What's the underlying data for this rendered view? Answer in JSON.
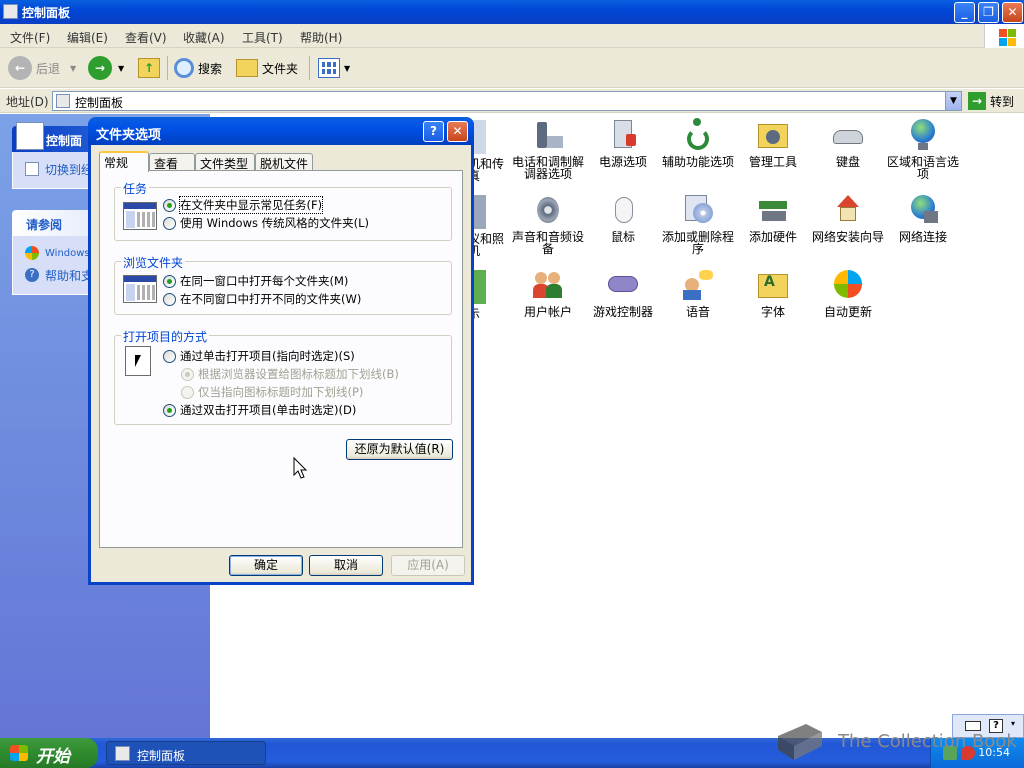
{
  "window": {
    "title": "控制面板",
    "menu": [
      "文件(F)",
      "编辑(E)",
      "查看(V)",
      "收藏(A)",
      "工具(T)",
      "帮助(H)"
    ],
    "toolbar": {
      "back": "后退",
      "search": "搜索",
      "folders": "文件夹"
    },
    "address": {
      "label": "地址(D)",
      "value": "控制面板",
      "go": "转到"
    }
  },
  "leftpane": {
    "panel_title": "控制面",
    "switch_view": "切换到经典视图",
    "see_also_title": "请参阅",
    "see_also": [
      "Windows Update",
      "帮助和支持"
    ]
  },
  "cp_items": [
    {
      "id": "phone",
      "label": "电话和调制解调器选项"
    },
    {
      "id": "power",
      "label": "电源选项"
    },
    {
      "id": "access",
      "label": "辅助功能选项"
    },
    {
      "id": "admin",
      "label": "管理工具"
    },
    {
      "id": "keyboard",
      "label": "键盘"
    },
    {
      "id": "region",
      "label": "区域和语言选项"
    },
    {
      "id": "sound",
      "label": "声音和音频设备"
    },
    {
      "id": "mouse",
      "label": "鼠标"
    },
    {
      "id": "addremove",
      "label": "添加或删除程序"
    },
    {
      "id": "addhw",
      "label": "添加硬件"
    },
    {
      "id": "netsetup",
      "label": "网络安装向导"
    },
    {
      "id": "netconn",
      "label": "网络连接"
    },
    {
      "id": "users",
      "label": "用户帐户"
    },
    {
      "id": "game",
      "label": "游戏控制器"
    },
    {
      "id": "speech",
      "label": "语音"
    },
    {
      "id": "fonts",
      "label": "字体"
    },
    {
      "id": "autoupdate",
      "label": "自动更新"
    }
  ],
  "partial_items": {
    "r1a": "机和传",
    "r1b": "真",
    "r2a": "仪和照",
    "r2b": "机",
    "r3a": "示"
  },
  "dialog": {
    "title": "文件夹选项",
    "help": "?",
    "tabs": [
      "常规",
      "查看",
      "文件类型",
      "脱机文件"
    ],
    "groups": {
      "tasks": {
        "legend": "任务",
        "opt1": "在文件夹中显示常见任务(F)",
        "opt2": "使用 Windows 传统风格的文件夹(L)"
      },
      "browse": {
        "legend": "浏览文件夹",
        "opt1": "在同一窗口中打开每个文件夹(M)",
        "opt2": "在不同窗口中打开不同的文件夹(W)"
      },
      "click": {
        "legend": "打开项目的方式",
        "opt1": "通过单击打开项目(指向时选定)(S)",
        "sub1": "根据浏览器设置给图标标题加下划线(B)",
        "sub2": "仅当指向图标标题时加下划线(P)",
        "opt2": "通过双击打开项目(单击时选定)(D)"
      }
    },
    "restore": "还原为默认值(R)",
    "ok": "确定",
    "cancel": "取消",
    "apply": "应用(A)"
  },
  "taskbar": {
    "start": "开始",
    "task": "控制面板",
    "clock": "10:54"
  },
  "watermark": "The Collection Book",
  "colors": {
    "xp_blue": "#0a5fe0",
    "dialog_bg": "#ece9d8",
    "start_green": "#3c9a3c",
    "legend_blue": "#0046d5"
  }
}
